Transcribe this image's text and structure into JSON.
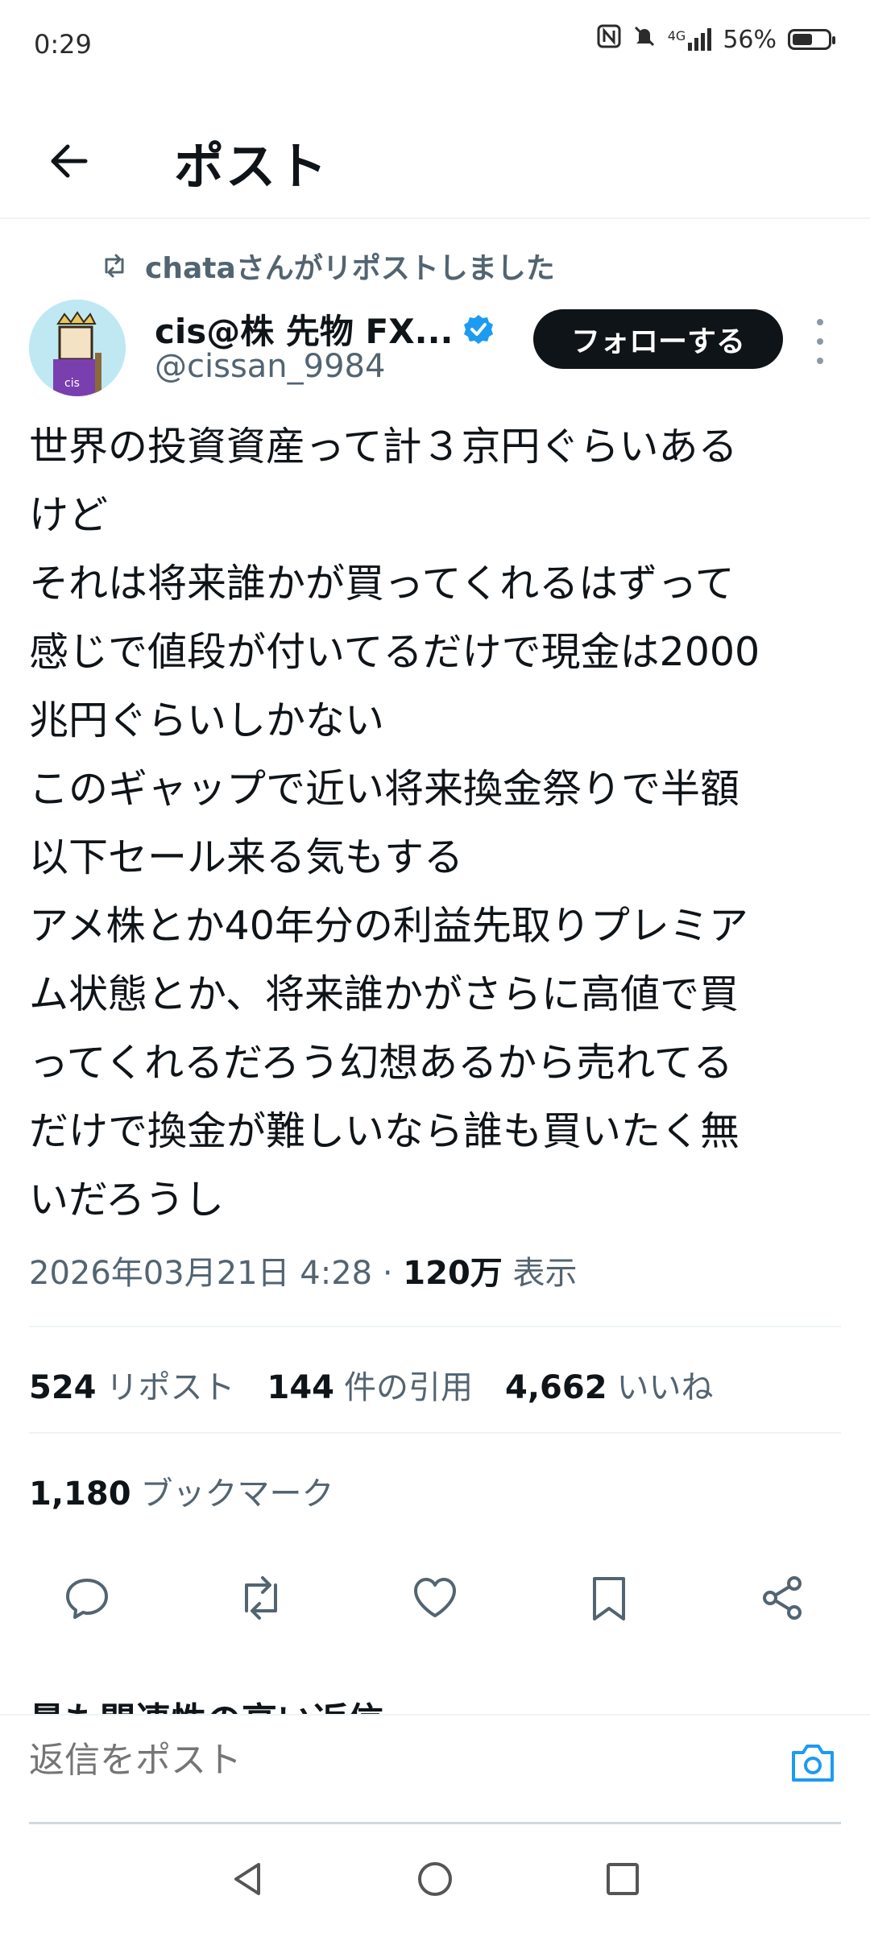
{
  "status_bar": {
    "time": "0:29",
    "network": "4G",
    "battery_percent": "56%",
    "battery_level": 0.56
  },
  "header": {
    "back_icon": "arrow-left-icon",
    "title": "ポスト"
  },
  "repost_context": {
    "icon": "repost-icon",
    "text": "chataさんがリポストしました"
  },
  "author": {
    "name": "cis@株 先物 FX...",
    "handle": "@cissan_9984",
    "verified": true,
    "follow_label": "フォローする"
  },
  "tweet": {
    "text": "世界の投資資産って計３京円ぐらいある\nけど\nそれは将来誰かが買ってくれるはずって\n感じで値段が付いてるだけで現金は2000\n兆円ぐらいしかない\nこのギャップで近い将来換金祭りで半額\n以下セール来る気もする\nアメ株とか40年分の利益先取りプレミア\nム状態とか、将来誰かがさらに高値で買\nってくれるだろう幻想あるから売れてる\nだけで換金が難しいなら誰も買いたく無\nいだろうし",
    "timestamp": "2026年03月21日 4:28",
    "separator": "·",
    "views_count": "120万",
    "views_label": "表示"
  },
  "stats": {
    "reposts_count": "524",
    "reposts_label": "リポスト",
    "quotes_count": "144",
    "quotes_label": "件の引用",
    "likes_count": "4,662",
    "likes_label": "いいね",
    "bookmarks_count": "1,180",
    "bookmarks_label": "ブックマーク"
  },
  "actions": [
    "reply-icon",
    "repost-icon",
    "like-icon",
    "bookmark-icon",
    "share-icon"
  ],
  "replies": {
    "sort_label": "最も関連性の高い返信"
  },
  "composer": {
    "placeholder": "返信をポスト",
    "camera_icon": "camera-icon"
  },
  "nav": [
    "back-triangle-icon",
    "home-circle-icon",
    "recents-square-icon"
  ],
  "colors": {
    "accent": "#1d9bf0",
    "text": "#0f1419",
    "secondary": "#536471",
    "divider": "#eff3f4"
  }
}
